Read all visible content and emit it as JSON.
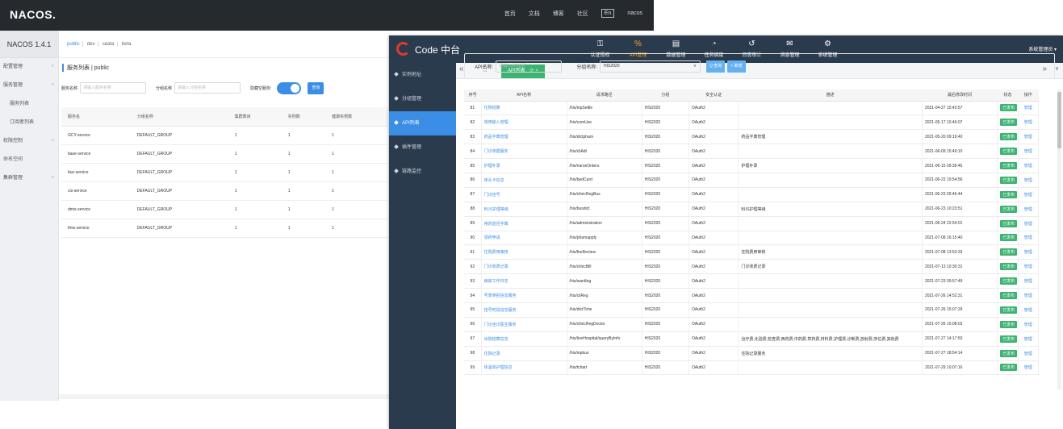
{
  "nacos": {
    "logo": "NACOS.",
    "nav": [
      "首页",
      "文档",
      "博客",
      "社区",
      "En",
      "nacos"
    ],
    "version": "NACOS 1.4.1",
    "sidebar": [
      {
        "label": "配置管理",
        "arrow": true,
        "sub": false
      },
      {
        "label": "服务管理",
        "arrow": true,
        "sub": false
      },
      {
        "label": "服务列表",
        "arrow": false,
        "sub": true
      },
      {
        "label": "订阅者列表",
        "arrow": false,
        "sub": true
      },
      {
        "label": "权限控制",
        "arrow": true,
        "sub": false
      },
      {
        "label": "命名空间",
        "arrow": false,
        "sub": false
      },
      {
        "label": "集群管理",
        "arrow": true,
        "sub": false
      }
    ],
    "namespaces": [
      "public",
      "dev",
      "seata",
      "beta"
    ],
    "title": "服务列表  |  public",
    "filters": {
      "service_label": "服务名称",
      "service_placeholder": "请输入服务名称",
      "group_label": "分组名称",
      "group_placeholder": "请输入分组名称",
      "hide_empty_label": "隐藏空服务:",
      "query_button": "查询"
    },
    "table": {
      "headers": [
        "服务名",
        "分组名称",
        "集群数目",
        "实例数",
        "健康实例数"
      ],
      "rows": [
        [
          "GCY-service",
          "DEFAULT_GROUP",
          "1",
          "1",
          "1"
        ],
        [
          "base-service",
          "DEFAULT_GROUP",
          "1",
          "1",
          "1"
        ],
        [
          "bus-service",
          "DEFAULT_GROUP",
          "1",
          "1",
          "1"
        ],
        [
          "cis-service",
          "DEFAULT_GROUP",
          "1",
          "1",
          "1"
        ],
        [
          "dmis-service",
          "DEFAULT_GROUP",
          "1",
          "1",
          "1"
        ],
        [
          "fmis-service",
          "DEFAULT_GROUP",
          "1",
          "1",
          "1"
        ]
      ]
    }
  },
  "code": {
    "brand": "Code 中台",
    "menu": [
      {
        "icon": "key-icon",
        "glyph": "⚿",
        "label": "认证授权",
        "active": false
      },
      {
        "icon": "link-icon",
        "glyph": "%",
        "label": "API管理",
        "active": true
      },
      {
        "icon": "database-icon",
        "glyph": "▤",
        "label": "数据管理",
        "active": false
      },
      {
        "icon": "dashboard-icon",
        "glyph": "◔",
        "label": "任务调度",
        "active": false
      },
      {
        "icon": "history-icon",
        "glyph": "↺",
        "label": "日志审计",
        "active": false
      },
      {
        "icon": "mail-icon",
        "glyph": "✉",
        "label": "消息管理",
        "active": false
      },
      {
        "icon": "cogs-icon",
        "glyph": "⚙",
        "label": "系统管理",
        "active": false
      }
    ],
    "user": "系统管理员 ▾",
    "sidebar": [
      {
        "label": "实例地址",
        "active": false
      },
      {
        "label": "分组管理",
        "active": false
      },
      {
        "label": "API列表",
        "active": true
      },
      {
        "label": "插件管理",
        "active": false
      },
      {
        "label": "链路监控",
        "active": false
      }
    ],
    "tabs": {
      "back": "«",
      "home": "⌂",
      "active_tab": "API列表",
      "forward": "»",
      "more": "∨"
    },
    "filter": {
      "api_label": "API名称:",
      "api_placeholder": "请输入API名称",
      "group_label": "分组名称:",
      "group_value": "HIS2020",
      "search_button": "Q 查询",
      "add_button": "+ 新增"
    },
    "table": {
      "headers": [
        "序号",
        "API名称",
        "请求路径",
        "分组",
        "安全认证",
        "描述",
        "最后修改时间",
        "状态",
        "操作"
      ],
      "rows": [
        [
          "81",
          "住院结算",
          "/his/inpSettle",
          "HIS2020",
          "OAuth2",
          "",
          "2021-04-27 15:43:57",
          "已发布",
          "管理"
        ],
        [
          "82",
          "常用输入管理",
          "/his/comUse",
          "HIS2020",
          "OAuth2",
          "",
          "2021-05-17 10:46:07",
          "已发布",
          "管理"
        ],
        [
          "83",
          "药品字典管理",
          "/his/dictpham",
          "HIS2020",
          "OAuth2",
          "药品字典管理",
          "2021-05-20 09:19:40",
          "已发布",
          "管理"
        ],
        [
          "84",
          "门诊单据服务",
          "/his/cliAdt",
          "HIS2020",
          "OAuth2",
          "",
          "2021-06-09 15:49:10",
          "已发布",
          "管理"
        ],
        [
          "85",
          "护理补录",
          "/his/nurseOrders",
          "HIS2020",
          "OAuth2",
          "护理补录",
          "2021-06-15 09:39:45",
          "已发布",
          "管理"
        ],
        [
          "86",
          "床头卡信息",
          "/his/bedCard",
          "HIS2020",
          "OAuth2",
          "",
          "2021-06-22 19:54:56",
          "已发布",
          "管理"
        ],
        [
          "87",
          "门诊挂号",
          "/his/clinicRegBus",
          "HIS2020",
          "OAuth2",
          "",
          "2021-06-23 09:46:44",
          "已发布",
          "管理"
        ],
        [
          "88",
          "BUS护理等级",
          "/his/busdict",
          "HIS2020",
          "OAuth2",
          "BUS护理等级",
          "2021-06-23 10:23:51",
          "已发布",
          "管理"
        ],
        [
          "89",
          "用药途径字典",
          "/his/administration",
          "HIS2020",
          "OAuth2",
          "",
          "2021-06-24 22:54:01",
          "已发布",
          "管理"
        ],
        [
          "90",
          "领药申请",
          "/his/phamapply",
          "HIS2020",
          "OAuth2",
          "",
          "2021-07-08 16:15:40",
          "已发布",
          "管理"
        ],
        [
          "91",
          "住院费用审核",
          "/his/feeReview",
          "HIS2020",
          "OAuth2",
          "住院费用审核",
          "2021-07-08 13:53:33",
          "已发布",
          "管理"
        ],
        [
          "92",
          "门诊收费记录",
          "/his/clinicBill",
          "HIS2020",
          "OAuth2",
          "门诊收费记录",
          "2021-07-13 10:30:31",
          "已发布",
          "管理"
        ],
        [
          "93",
          "病房工作日志",
          "/his/wardlog",
          "HIS2020",
          "OAuth2",
          "",
          "2021-07-23 09:57:49",
          "已发布",
          "管理"
        ],
        [
          "94",
          "号表类别信息服务",
          "/his/cliReg",
          "HIS2020",
          "OAuth2",
          "",
          "2021-07-26 14:52:31",
          "已发布",
          "管理"
        ],
        [
          "95",
          "挂号时段信息服务",
          "/his/dictTime",
          "HIS2020",
          "OAuth2",
          "",
          "2021-07-26 15:07:29",
          "已发布",
          "管理"
        ],
        [
          "96",
          "门诊坐诊医生服务",
          "/his/clinicRegDoctor",
          "HIS2020",
          "OAuth2",
          "",
          "2021-07-26 15:08:03",
          "已发布",
          "管理"
        ],
        [
          "97",
          "出院结算信息",
          "/his/liveHospital/queryByInfo",
          "HIS2020",
          "OAuth2",
          "治疗费,化验费,检查费,西药费,中药费,草药费,材料费,护理费,诊断费,放射费,床位费,其他费",
          "2021-07-27 14:17:50",
          "已发布",
          "管理"
        ],
        [
          "98",
          "住院记录",
          "/his/inpbus",
          "HIS2020",
          "OAuth2",
          "住院记录服务",
          "2021-07-27 18:54:14",
          "已发布",
          "管理"
        ],
        [
          "99",
          "体温单护理信息",
          "/his/tchart",
          "HIS2020",
          "OAuth2",
          "",
          "2021-07-29 10:07:16",
          "已发布",
          "管理"
        ]
      ]
    }
  }
}
